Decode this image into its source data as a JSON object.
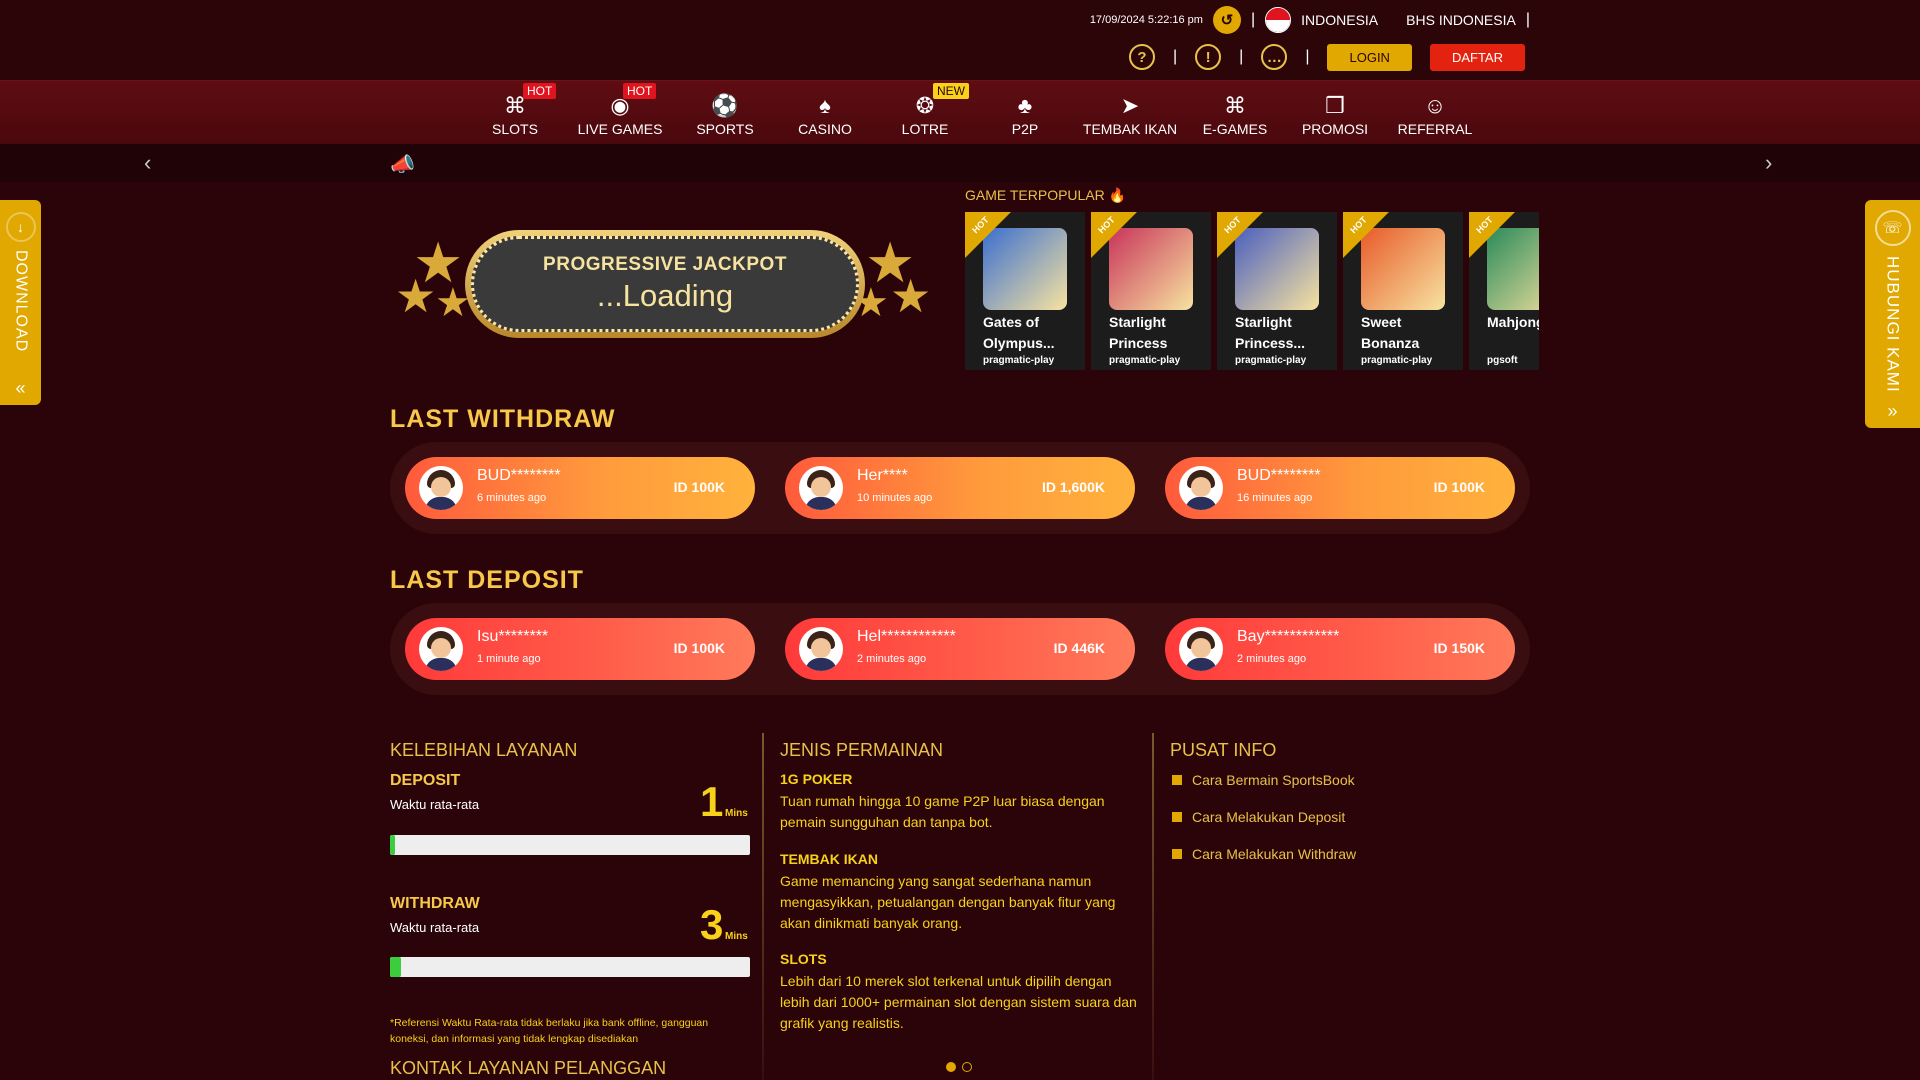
{
  "header": {
    "datetime": "17/09/2024 5:22:16 pm",
    "country": "INDONESIA",
    "language": "BHS INDONESIA",
    "login_label": "LOGIN",
    "register_label": "DAFTAR"
  },
  "nav": [
    {
      "label": "SLOTS",
      "badge": "HOT",
      "icon": "slot-machine-icon"
    },
    {
      "label": "LIVE GAMES",
      "badge": "HOT",
      "icon": "live-icon"
    },
    {
      "label": "SPORTS",
      "badge": "",
      "icon": "soccer-ball-icon"
    },
    {
      "label": "CASINO",
      "badge": "",
      "icon": "card-icon"
    },
    {
      "label": "LOTRE",
      "badge": "NEW",
      "icon": "lottery-icon"
    },
    {
      "label": "P2P",
      "badge": "",
      "icon": "p2p-cards-icon"
    },
    {
      "label": "TEMBAK IKAN",
      "badge": "",
      "icon": "fish-icon"
    },
    {
      "label": "E-GAMES",
      "badge": "",
      "icon": "gamepad-icon"
    },
    {
      "label": "PROMOSI",
      "badge": "",
      "icon": "gift-icon"
    },
    {
      "label": "REFERRAL",
      "badge": "",
      "icon": "referral-icon"
    }
  ],
  "side": {
    "download_label": "DOWNLOAD",
    "contact_label": "HUBUNGI KAMI"
  },
  "jackpot": {
    "title": "PROGRESSIVE JACKPOT",
    "status": "...Loading"
  },
  "popular": {
    "title": "GAME TERPOPULAR",
    "ribbon": "HOT",
    "games": [
      {
        "name": "Gates of Olympus...",
        "provider": "pragmatic-play",
        "color": "#3a6fd0"
      },
      {
        "name": "Starlight Princess",
        "provider": "pragmatic-play",
        "color": "#c8345a"
      },
      {
        "name": "Starlight Princess...",
        "provider": "pragmatic-play",
        "color": "#4a5fc0"
      },
      {
        "name": "Sweet Bonanza",
        "provider": "pragmatic-play",
        "color": "#e85a2a"
      },
      {
        "name": "Mahjong Ways",
        "provider": "pgsoft",
        "color": "#2a8a5a"
      }
    ]
  },
  "withdraw": {
    "title": "LAST WITHDRAW",
    "items": [
      {
        "name": "BUD********",
        "time": "6 minutes ago",
        "amount": "ID 100K"
      },
      {
        "name": "Her****",
        "time": "10 minutes ago",
        "amount": "ID 1,600K"
      },
      {
        "name": "BUD********",
        "time": "16 minutes ago",
        "amount": "ID 100K"
      }
    ]
  },
  "deposit": {
    "title": "LAST DEPOSIT",
    "items": [
      {
        "name": "Isu********",
        "time": "1 minute ago",
        "amount": "ID 100K"
      },
      {
        "name": "Hel************",
        "time": "2 minutes ago",
        "amount": "ID 446K"
      },
      {
        "name": "Bay************",
        "time": "2 minutes ago",
        "amount": "ID 150K"
      }
    ]
  },
  "service": {
    "title": "KELEBIHAN LAYANAN",
    "deposit_label": "DEPOSIT",
    "deposit_sub": "Waktu rata-rata",
    "deposit_value": "1",
    "deposit_unit": "Mins",
    "deposit_progress": 0.015,
    "withdraw_label": "WITHDRAW",
    "withdraw_sub": "Waktu rata-rata",
    "withdraw_value": "3",
    "withdraw_unit": "Mins",
    "withdraw_progress": 0.03,
    "note": "*Referensi Waktu Rata-rata tidak berlaku jika bank offline, gangguan koneksi, dan informasi yang tidak lengkap disediakan",
    "contact_title": "KONTAK LAYANAN PELANGGAN"
  },
  "jenis": {
    "title": "JENIS PERMAINAN",
    "items": [
      {
        "title": "1G POKER",
        "desc": "Tuan rumah hingga 10 game P2P luar biasa dengan pemain sungguhan dan tanpa bot."
      },
      {
        "title": "TEMBAK IKAN",
        "desc": "Game memancing yang sangat sederhana namun mengasyikkan, petualangan dengan banyak fitur yang akan dinikmati banyak orang."
      },
      {
        "title": "SLOTS",
        "desc": "Lebih dari 10 merek slot terkenal untuk dipilih dengan lebih dari 1000+ permainan slot dengan sistem suara dan grafik yang realistis."
      }
    ]
  },
  "pusat": {
    "title": "PUSAT INFO",
    "items": [
      "Cara Bermain SportsBook",
      "Cara Melakukan Deposit",
      "Cara Melakukan Withdraw"
    ]
  }
}
